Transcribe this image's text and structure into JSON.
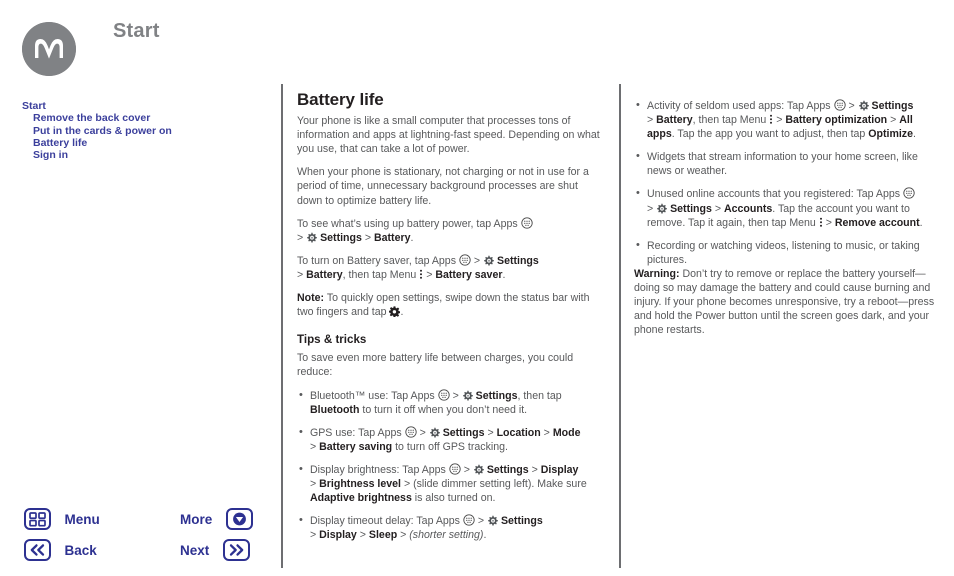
{
  "header": {
    "title": "Start",
    "logo_icon": "motorola-logo-icon",
    "logo_color": "#808285",
    "title_color": "#808285"
  },
  "accent_color": "#2d3191",
  "toc": {
    "items": [
      {
        "label": "Start",
        "level": 0
      },
      {
        "label": "Remove the back cover",
        "level": 1
      },
      {
        "label": "Put in the cards & power on",
        "level": 1
      },
      {
        "label": "Battery life",
        "level": 1
      },
      {
        "label": "Sign in",
        "level": 1
      }
    ]
  },
  "middle_column": {
    "heading": "Battery life",
    "paragraph_1": "Your phone is like a small computer that processes tons of information and apps at lightning-fast speed. Depending on what you use, that can take a lot of power.",
    "paragraph_2": "When your phone is stationary, not charging or not in use for a period of time, unnecessary background processes are shut down to optimize battery life.",
    "battery_power": {
      "lead": "To see what’s using up battery power, tap Apps",
      "arrow_1": ">",
      "settings": "Settings",
      "arrow_2": ">",
      "battery": "Battery",
      "period": "."
    },
    "battery_saver": {
      "lead": "To turn on Battery saver, tap Apps",
      "arrow_1": ">",
      "settings": "Settings",
      "arrow_2": ">",
      "battery": "Battery",
      "mid": ", then tap Menu",
      "arrow_3": ">",
      "saver": "Battery saver",
      "period": "."
    },
    "note": {
      "label": "Note:",
      "text": " To quickly open settings, swipe down the status bar with two fingers and tap",
      "period": "."
    },
    "tips_heading": "Tips & tricks",
    "tips_intro": "To save even more battery life between charges, you could reduce:",
    "tips": [
      {
        "p1": "Bluetooth™ use: Tap Apps",
        "a1": ">",
        "b1": "Settings",
        "p2": ", then tap ",
        "b2": "Bluetooth",
        "p3": " to turn it off when you don’t need it."
      },
      {
        "p1": "GPS use: Tap Apps",
        "a1": ">",
        "b1": "Settings",
        "a2": ">",
        "b2": "Location",
        "a3": ">",
        "b3": "Mode",
        "a4": ">",
        "b4": "Battery saving",
        "p3": " to turn off GPS tracking."
      },
      {
        "p1": "Display brightness: Tap Apps",
        "a1": ">",
        "b1": "Settings",
        "a2": ">",
        "b2": "Display",
        "a3": ">",
        "b3": "Brightness level",
        "a4": ">",
        "p3": " (slide dimmer setting left). Make sure ",
        "b4": "Adaptive brightness",
        "p4": " is also turned on."
      },
      {
        "p1": "Display timeout delay: Tap Apps",
        "a1": ">",
        "b1": "Settings",
        "a2": ">",
        "b2": "Display",
        "a3": ">",
        "b3": "Sleep",
        "a4": ">",
        "i1": "(shorter setting)",
        "p4": "."
      }
    ]
  },
  "right_column": {
    "bullets": [
      {
        "p1": "Activity of seldom used apps: Tap Apps",
        "a1": ">",
        "b1": "Settings",
        "a2": ">",
        "b2": "Battery",
        "p2": ", then tap Menu",
        "a3": ">",
        "b3": "Battery optimization",
        "a4": ">",
        "b4": "All apps",
        "p3": ". Tap the app you want to adjust, then tap ",
        "b5": "Optimize",
        "p4": "."
      },
      {
        "p1": "Widgets that stream information to your home screen, like news or weather."
      },
      {
        "p1": "Unused online accounts that you registered: Tap Apps",
        "a1": ">",
        "b1": "Settings",
        "a2": ">",
        "b2": "Accounts",
        "p2": ". Tap the account you want to remove. Tap it again, then tap Menu",
        "a3": ">",
        "b3": "Remove account",
        "p4": "."
      },
      {
        "p1": "Recording or watching videos, listening to music, or taking pictures."
      }
    ],
    "warning": {
      "label": "Warning:",
      "text": " Don’t try to remove or replace the battery yourself—doing so may damage the battery and could cause burning and injury. If your phone becomes unresponsive, try a reboot—press and hold the Power button until the screen goes dark, and your phone restarts."
    }
  },
  "bottom_nav": {
    "menu_label": "Menu",
    "menu_icon": "grid-icon",
    "back_label": "Back",
    "back_icon": "double-chevron-left-icon",
    "more_label": "More",
    "more_icon": "circle-down-arrow-icon",
    "next_label": "Next",
    "next_icon": "double-chevron-right-icon"
  }
}
